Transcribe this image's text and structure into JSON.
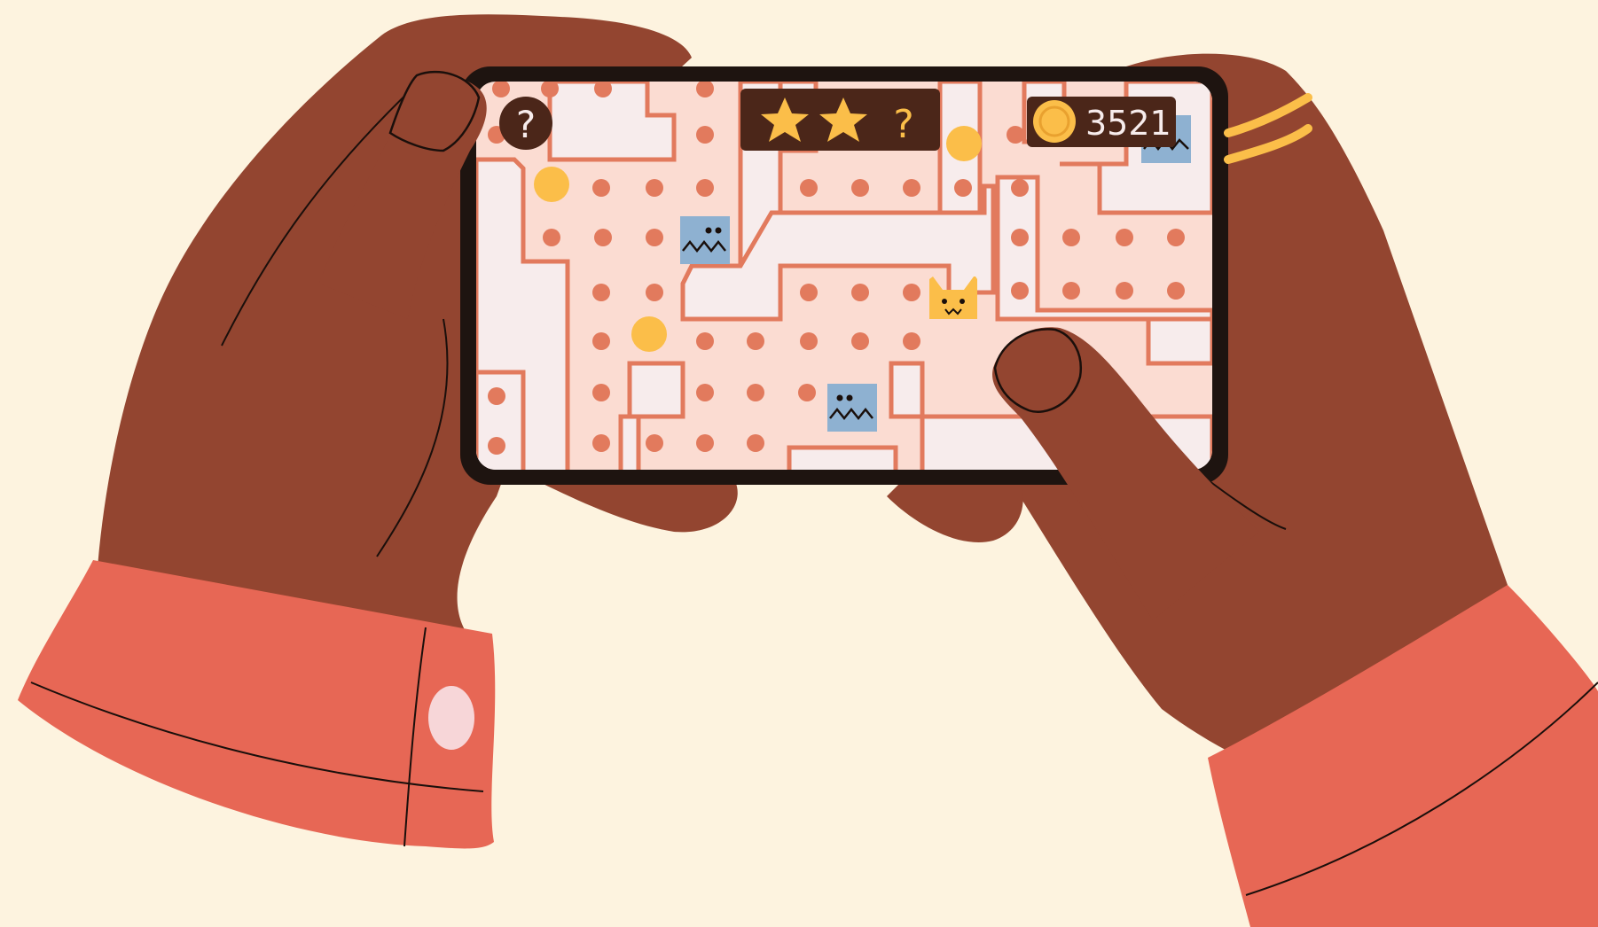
{
  "hud": {
    "help_symbol": "?",
    "stars_earned": 2,
    "stars_total": 3,
    "missing_star_symbol": "?",
    "coin_count": "3521"
  },
  "game_colors": {
    "background": "#fdf3df",
    "skin": "#934530",
    "sleeve": "#e76755",
    "phone_frame": "#1e1410",
    "screen_floor": "#fbdcd2",
    "screen_wall": "#f7ecec",
    "maze_line": "#e27a5d",
    "pellet": "#e27a5d",
    "power_pellet": "#fbbe49",
    "ghost": "#8eb1d1",
    "player_cat": "#fbbe49",
    "hud_panel": "#4b2619",
    "ring": "#fbbe49"
  },
  "icons": {
    "help": "question-mark-icon",
    "star": "star-icon",
    "coin": "coin-icon",
    "player": "cat-icon",
    "enemy": "ghost-icon"
  }
}
